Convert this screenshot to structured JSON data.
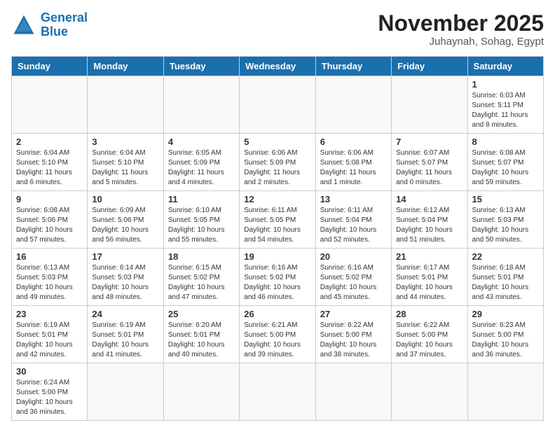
{
  "header": {
    "logo_general": "General",
    "logo_blue": "Blue",
    "month": "November 2025",
    "location": "Juhaynah, Sohag, Egypt"
  },
  "weekdays": [
    "Sunday",
    "Monday",
    "Tuesday",
    "Wednesday",
    "Thursday",
    "Friday",
    "Saturday"
  ],
  "weeks": [
    [
      {
        "day": "",
        "info": ""
      },
      {
        "day": "",
        "info": ""
      },
      {
        "day": "",
        "info": ""
      },
      {
        "day": "",
        "info": ""
      },
      {
        "day": "",
        "info": ""
      },
      {
        "day": "",
        "info": ""
      },
      {
        "day": "1",
        "info": "Sunrise: 6:03 AM\nSunset: 5:11 PM\nDaylight: 11 hours\nand 8 minutes."
      }
    ],
    [
      {
        "day": "2",
        "info": "Sunrise: 6:04 AM\nSunset: 5:10 PM\nDaylight: 11 hours\nand 6 minutes."
      },
      {
        "day": "3",
        "info": "Sunrise: 6:04 AM\nSunset: 5:10 PM\nDaylight: 11 hours\nand 5 minutes."
      },
      {
        "day": "4",
        "info": "Sunrise: 6:05 AM\nSunset: 5:09 PM\nDaylight: 11 hours\nand 4 minutes."
      },
      {
        "day": "5",
        "info": "Sunrise: 6:06 AM\nSunset: 5:09 PM\nDaylight: 11 hours\nand 2 minutes."
      },
      {
        "day": "6",
        "info": "Sunrise: 6:06 AM\nSunset: 5:08 PM\nDaylight: 11 hours\nand 1 minute."
      },
      {
        "day": "7",
        "info": "Sunrise: 6:07 AM\nSunset: 5:07 PM\nDaylight: 11 hours\nand 0 minutes."
      },
      {
        "day": "8",
        "info": "Sunrise: 6:08 AM\nSunset: 5:07 PM\nDaylight: 10 hours\nand 59 minutes."
      }
    ],
    [
      {
        "day": "9",
        "info": "Sunrise: 6:08 AM\nSunset: 5:06 PM\nDaylight: 10 hours\nand 57 minutes."
      },
      {
        "day": "10",
        "info": "Sunrise: 6:09 AM\nSunset: 5:06 PM\nDaylight: 10 hours\nand 56 minutes."
      },
      {
        "day": "11",
        "info": "Sunrise: 6:10 AM\nSunset: 5:05 PM\nDaylight: 10 hours\nand 55 minutes."
      },
      {
        "day": "12",
        "info": "Sunrise: 6:11 AM\nSunset: 5:05 PM\nDaylight: 10 hours\nand 54 minutes."
      },
      {
        "day": "13",
        "info": "Sunrise: 6:11 AM\nSunset: 5:04 PM\nDaylight: 10 hours\nand 52 minutes."
      },
      {
        "day": "14",
        "info": "Sunrise: 6:12 AM\nSunset: 5:04 PM\nDaylight: 10 hours\nand 51 minutes."
      },
      {
        "day": "15",
        "info": "Sunrise: 6:13 AM\nSunset: 5:03 PM\nDaylight: 10 hours\nand 50 minutes."
      }
    ],
    [
      {
        "day": "16",
        "info": "Sunrise: 6:13 AM\nSunset: 5:03 PM\nDaylight: 10 hours\nand 49 minutes."
      },
      {
        "day": "17",
        "info": "Sunrise: 6:14 AM\nSunset: 5:03 PM\nDaylight: 10 hours\nand 48 minutes."
      },
      {
        "day": "18",
        "info": "Sunrise: 6:15 AM\nSunset: 5:02 PM\nDaylight: 10 hours\nand 47 minutes."
      },
      {
        "day": "19",
        "info": "Sunrise: 6:16 AM\nSunset: 5:02 PM\nDaylight: 10 hours\nand 46 minutes."
      },
      {
        "day": "20",
        "info": "Sunrise: 6:16 AM\nSunset: 5:02 PM\nDaylight: 10 hours\nand 45 minutes."
      },
      {
        "day": "21",
        "info": "Sunrise: 6:17 AM\nSunset: 5:01 PM\nDaylight: 10 hours\nand 44 minutes."
      },
      {
        "day": "22",
        "info": "Sunrise: 6:18 AM\nSunset: 5:01 PM\nDaylight: 10 hours\nand 43 minutes."
      }
    ],
    [
      {
        "day": "23",
        "info": "Sunrise: 6:19 AM\nSunset: 5:01 PM\nDaylight: 10 hours\nand 42 minutes."
      },
      {
        "day": "24",
        "info": "Sunrise: 6:19 AM\nSunset: 5:01 PM\nDaylight: 10 hours\nand 41 minutes."
      },
      {
        "day": "25",
        "info": "Sunrise: 6:20 AM\nSunset: 5:01 PM\nDaylight: 10 hours\nand 40 minutes."
      },
      {
        "day": "26",
        "info": "Sunrise: 6:21 AM\nSunset: 5:00 PM\nDaylight: 10 hours\nand 39 minutes."
      },
      {
        "day": "27",
        "info": "Sunrise: 6:22 AM\nSunset: 5:00 PM\nDaylight: 10 hours\nand 38 minutes."
      },
      {
        "day": "28",
        "info": "Sunrise: 6:22 AM\nSunset: 5:00 PM\nDaylight: 10 hours\nand 37 minutes."
      },
      {
        "day": "29",
        "info": "Sunrise: 6:23 AM\nSunset: 5:00 PM\nDaylight: 10 hours\nand 36 minutes."
      }
    ],
    [
      {
        "day": "30",
        "info": "Sunrise: 6:24 AM\nSunset: 5:00 PM\nDaylight: 10 hours\nand 36 minutes."
      },
      {
        "day": "",
        "info": ""
      },
      {
        "day": "",
        "info": ""
      },
      {
        "day": "",
        "info": ""
      },
      {
        "day": "",
        "info": ""
      },
      {
        "day": "",
        "info": ""
      },
      {
        "day": "",
        "info": ""
      }
    ]
  ]
}
